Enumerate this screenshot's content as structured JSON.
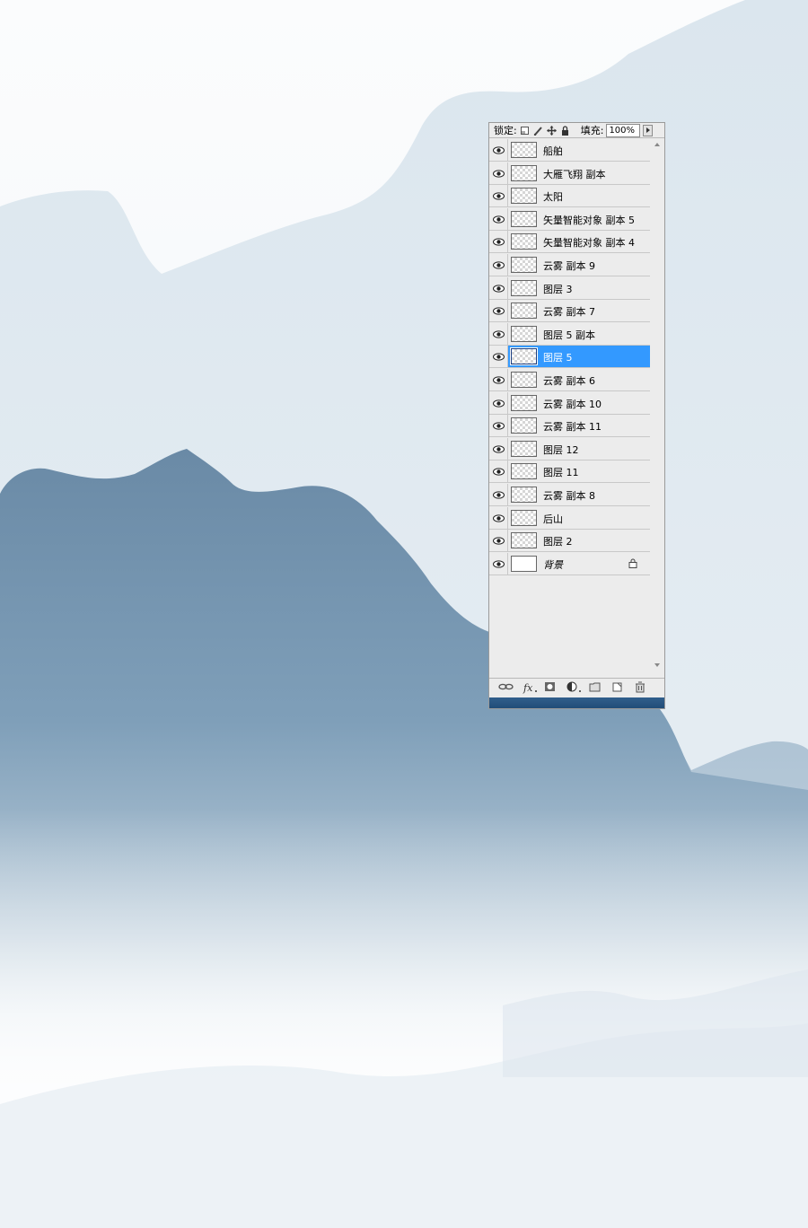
{
  "layers_panel": {
    "lock_label": "锁定:",
    "fill_label": "填充:",
    "fill_value": "100%",
    "layers": [
      {
        "name": "船舶",
        "thumb": "transparent",
        "selected": false,
        "visible": true
      },
      {
        "name": "大雁飞翔 副本",
        "thumb": "transparent",
        "selected": false,
        "visible": true
      },
      {
        "name": "太阳",
        "thumb": "transparent",
        "selected": false,
        "visible": true
      },
      {
        "name": "矢量智能对象 副本 5",
        "thumb": "transparent",
        "selected": false,
        "visible": true
      },
      {
        "name": "矢量智能对象 副本 4",
        "thumb": "transparent",
        "selected": false,
        "visible": true
      },
      {
        "name": "云雾 副本 9",
        "thumb": "transparent",
        "selected": false,
        "visible": true
      },
      {
        "name": "图层 3",
        "thumb": "transparent",
        "selected": false,
        "visible": true
      },
      {
        "name": "云雾 副本 7",
        "thumb": "transparent",
        "selected": false,
        "visible": true
      },
      {
        "name": "图层 5 副本",
        "thumb": "transparent",
        "selected": false,
        "visible": true
      },
      {
        "name": "图层 5",
        "thumb": "transparent",
        "selected": true,
        "visible": true
      },
      {
        "name": "云雾 副本 6",
        "thumb": "transparent",
        "selected": false,
        "visible": true
      },
      {
        "name": "云雾 副本 10",
        "thumb": "transparent",
        "selected": false,
        "visible": true
      },
      {
        "name": "云雾 副本 11",
        "thumb": "transparent",
        "selected": false,
        "visible": true
      },
      {
        "name": "图层 12",
        "thumb": "transparent",
        "selected": false,
        "visible": true
      },
      {
        "name": "图层 11",
        "thumb": "transparent",
        "selected": false,
        "visible": true
      },
      {
        "name": "云雾 副本 8",
        "thumb": "transparent",
        "selected": false,
        "visible": true
      },
      {
        "name": "后山",
        "thumb": "transparent",
        "selected": false,
        "visible": true
      },
      {
        "name": "图层 2",
        "thumb": "transparent",
        "selected": false,
        "visible": true
      },
      {
        "name": "背景",
        "thumb": "white",
        "selected": false,
        "visible": true,
        "locked": true,
        "italic": true
      }
    ]
  },
  "colors": {
    "selection": "#3399ff",
    "mountain_dark": "#6a8aa6",
    "mountain_light": "#c9d7e3",
    "sky": "#f4f7fa"
  }
}
